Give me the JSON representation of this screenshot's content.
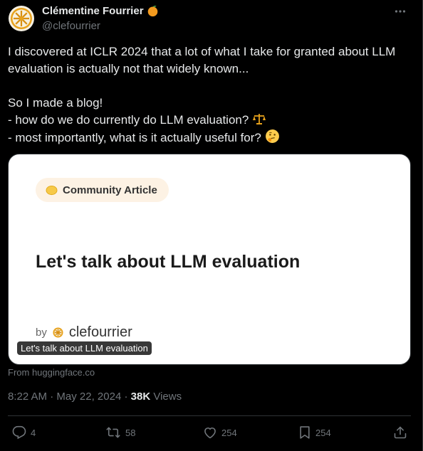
{
  "author": {
    "name": "Clémentine Fourrier",
    "name_emoji": "orange-emoji",
    "handle": "@clefourrier",
    "avatar_icon": "orange-slice-avatar"
  },
  "tweet": {
    "line1": "I discovered at ICLR 2024 that a lot of what I take for granted about LLM evaluation is actually not that widely known...",
    "line2": "So I made a blog!",
    "line3": "- how do we do currently do LLM evaluation?",
    "line3_emoji": "balance-scale-emoji",
    "line4": "- most importantly, what is it actually useful for?",
    "line4_emoji": "thinking-face-emoji"
  },
  "card": {
    "badge": "Community Article",
    "title": "Let's talk about LLM evaluation",
    "by": "by",
    "author": "clefourrier",
    "tooltip": "Let's talk about LLM evaluation",
    "source": "From huggingface.co"
  },
  "meta": {
    "time": "8:22 AM",
    "sep1": " · ",
    "date": "May 22, 2024",
    "sep2": " · ",
    "views_count": "38K",
    "views_label": " Views"
  },
  "actions": {
    "replies": "4",
    "reposts": "58",
    "likes": "254",
    "bookmarks": "254"
  },
  "colors": {
    "background": "#000000",
    "text": "#e7e9ea",
    "muted": "#71767b",
    "card_bg": "#ffffff",
    "badge_bg": "#fdf2e4"
  }
}
